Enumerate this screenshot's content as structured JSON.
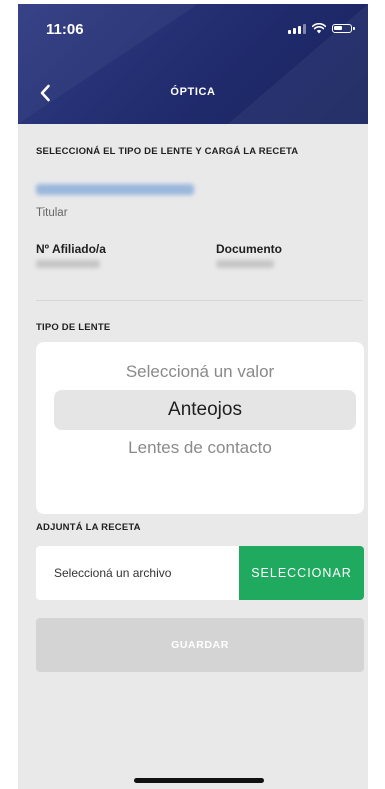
{
  "status_bar": {
    "time": "11:06",
    "icons": [
      "signal-icon",
      "wifi-icon",
      "battery-icon"
    ]
  },
  "nav": {
    "back_icon": "chevron-left-icon",
    "title": "ÓPTICA"
  },
  "form": {
    "heading": "SELECCIONÁ EL TIPO DE LENTE Y CARGÁ LA RECETA",
    "holder": {
      "role": "Titular"
    },
    "fields": {
      "affiliate_label": "Nº Afiliado/a",
      "document_label": "Documento"
    },
    "lens_type": {
      "label": "TIPO DE LENTE",
      "placeholder": "Seleccioná un valor",
      "selected": "Anteojos",
      "option_other": "Lentes de contacto"
    },
    "attachment": {
      "label": "ADJUNTÁ LA RECETA",
      "placeholder": "Seleccioná un archivo",
      "button": "SELECCIONAR"
    },
    "save_button": "GUARDAR"
  },
  "colors": {
    "header": "#1f2a6b",
    "accent_green": "#1faa5f",
    "background": "#e9e9ea",
    "disabled_button": "#d4d4d5"
  }
}
